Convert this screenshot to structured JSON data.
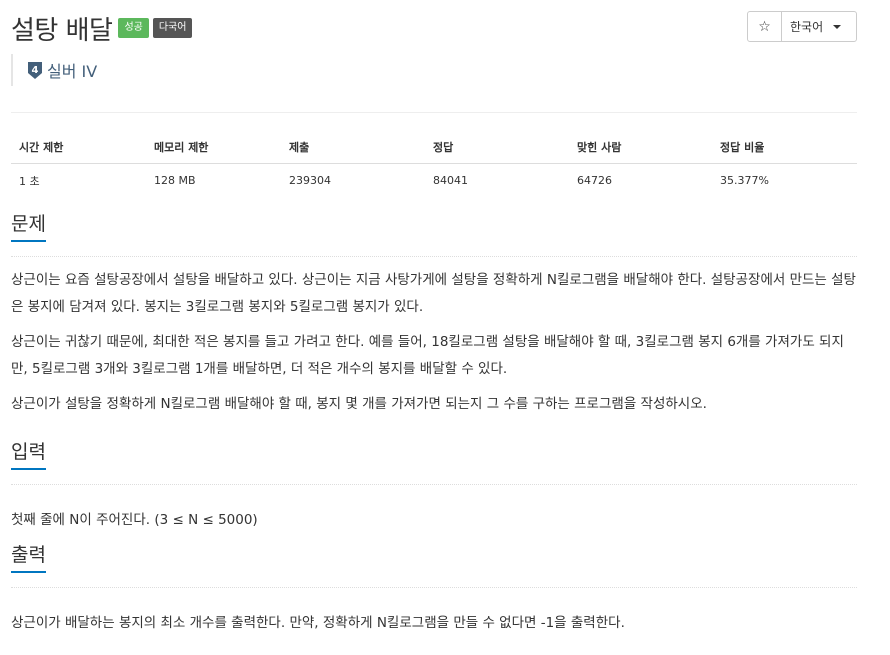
{
  "problem": {
    "title": "설탕 배달",
    "badges": [
      "성공",
      "다국어"
    ],
    "tier_number": "4",
    "tier_label": "실버 IV"
  },
  "controls": {
    "star": "☆",
    "language": "한국어"
  },
  "info_table": {
    "headers": [
      "시간 제한",
      "메모리 제한",
      "제출",
      "정답",
      "맞힌 사람",
      "정답 비율"
    ],
    "values": [
      "1 초",
      "128 MB",
      "239304",
      "84041",
      "64726",
      "35.377%"
    ]
  },
  "sections": {
    "problem": {
      "title": "문제",
      "paragraphs": [
        "상근이는 요즘 설탕공장에서 설탕을 배달하고 있다. 상근이는 지금 사탕가게에 설탕을 정확하게 N킬로그램을 배달해야 한다. 설탕공장에서 만드는 설탕은 봉지에 담겨져 있다. 봉지는 3킬로그램 봉지와 5킬로그램 봉지가 있다.",
        "상근이는 귀찮기 때문에, 최대한 적은 봉지를 들고 가려고 한다. 예를 들어, 18킬로그램 설탕을 배달해야 할 때, 3킬로그램 봉지 6개를 가져가도 되지만, 5킬로그램 3개와 3킬로그램 1개를 배달하면, 더 적은 개수의 봉지를 배달할 수 있다.",
        "상근이가 설탕을 정확하게 N킬로그램 배달해야 할 때, 봉지 몇 개를 가져가면 되는지 그 수를 구하는 프로그램을 작성하시오."
      ]
    },
    "input": {
      "title": "입력",
      "paragraphs": [
        "첫째 줄에 N이 주어진다. (3 ≤ N ≤ 5000)"
      ]
    },
    "output": {
      "title": "출력",
      "paragraphs": [
        "상근이가 배달하는 봉지의 최소 개수를 출력한다. 만약, 정확하게 N킬로그램을 만들 수 없다면 -1을 출력한다."
      ]
    }
  }
}
